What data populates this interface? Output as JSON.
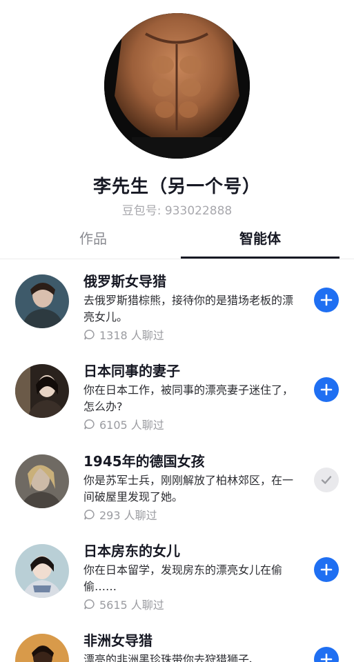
{
  "profile": {
    "name": "李先生（另一个号）",
    "id_label": "豆包号: 933022888"
  },
  "tabs": [
    {
      "label": "作品",
      "active": false
    },
    {
      "label": "智能体",
      "active": true
    }
  ],
  "agents": [
    {
      "title": "俄罗斯女导猎",
      "description": "去俄罗斯猎棕熊，接待你的是猎场老板的漂亮女儿。",
      "chats": "1318 人聊过",
      "action": "add",
      "action_icon": "plus-icon"
    },
    {
      "title": "日本同事的妻子",
      "description": "你在日本工作，被同事的漂亮妻子迷住了，怎么办?",
      "chats": "6105 人聊过",
      "action": "add",
      "action_icon": "plus-icon"
    },
    {
      "title": "1945年的德国女孩",
      "description": "你是苏军士兵，刚刚解放了柏林郊区，在一间破屋里发现了她。",
      "chats": "293 人聊过",
      "action": "added",
      "action_icon": "check-icon"
    },
    {
      "title": "日本房东的女儿",
      "description": "你在日本留学，发现房东的漂亮女儿在偷偷……",
      "chats": "5615 人聊过",
      "action": "add",
      "action_icon": "plus-icon"
    },
    {
      "title": "非洲女导猎",
      "description": "漂亮的非洲黑珍珠带你去狩猎狮子、",
      "chats": "",
      "action": "add",
      "action_icon": "plus-icon"
    }
  ],
  "colors": {
    "accent": "#1f6ff2",
    "text_primary": "#161823",
    "text_secondary": "#9a9ba0"
  }
}
